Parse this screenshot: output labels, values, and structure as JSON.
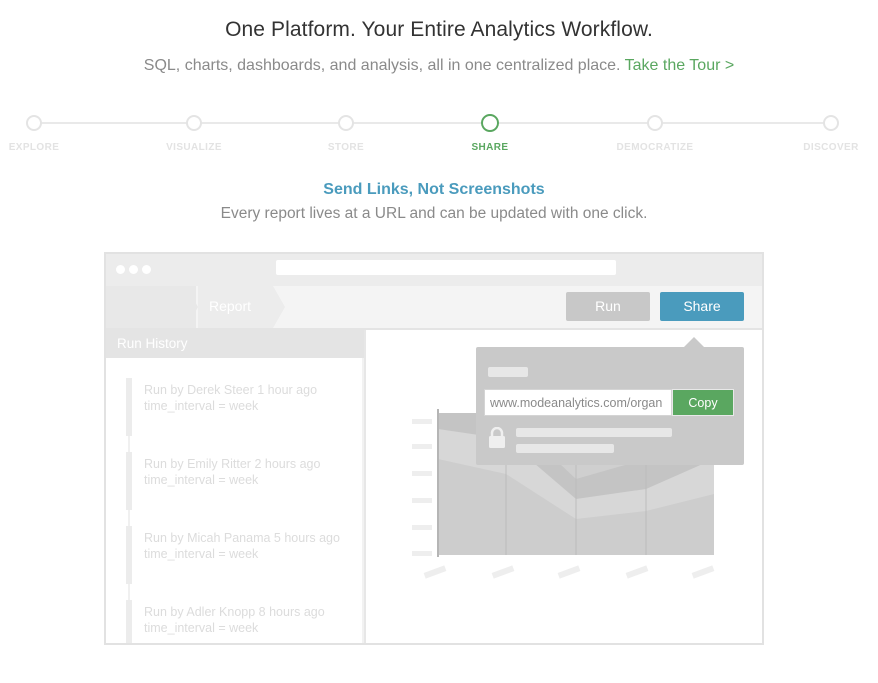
{
  "header": {
    "title": "One Platform. Your Entire Analytics Workflow.",
    "subtitle": "SQL, charts, dashboards, and analysis, all in one centralized place.",
    "tour_link": "Take the Tour >"
  },
  "colors": {
    "accent_green": "#5aa760",
    "accent_blue": "#4a9bbd",
    "muted_gray": "#8a8a8a"
  },
  "steps": [
    {
      "label": "EXPLORE",
      "active": false
    },
    {
      "label": "VISUALIZE",
      "active": false
    },
    {
      "label": "STORE",
      "active": false
    },
    {
      "label": "SHARE",
      "active": true
    },
    {
      "label": "DEMOCRATIZE",
      "active": false
    },
    {
      "label": "DISCOVER",
      "active": false
    }
  ],
  "section": {
    "title": "Send Links, Not Screenshots",
    "description": "Every report lives at a URL and can be updated with one click."
  },
  "mock": {
    "breadcrumb": "Report",
    "run_label": "Run",
    "share_label": "Share",
    "sidebar_title": "Run History",
    "runs": [
      {
        "by": "Run by Derek Steer 1 hour ago",
        "param": "time_interval = week"
      },
      {
        "by": "Run by Emily Ritter 2 hours ago",
        "param": "time_interval = week"
      },
      {
        "by": "Run by Micah Panama 5 hours ago",
        "param": "time_interval = week"
      },
      {
        "by": "Run by Adler Knopp  8 hours ago",
        "param": "time_interval = week"
      }
    ],
    "share_popover": {
      "url_value": "www.modeanalytics.com/organ",
      "copy_label": "Copy",
      "lock_icon": "lock-icon"
    }
  }
}
